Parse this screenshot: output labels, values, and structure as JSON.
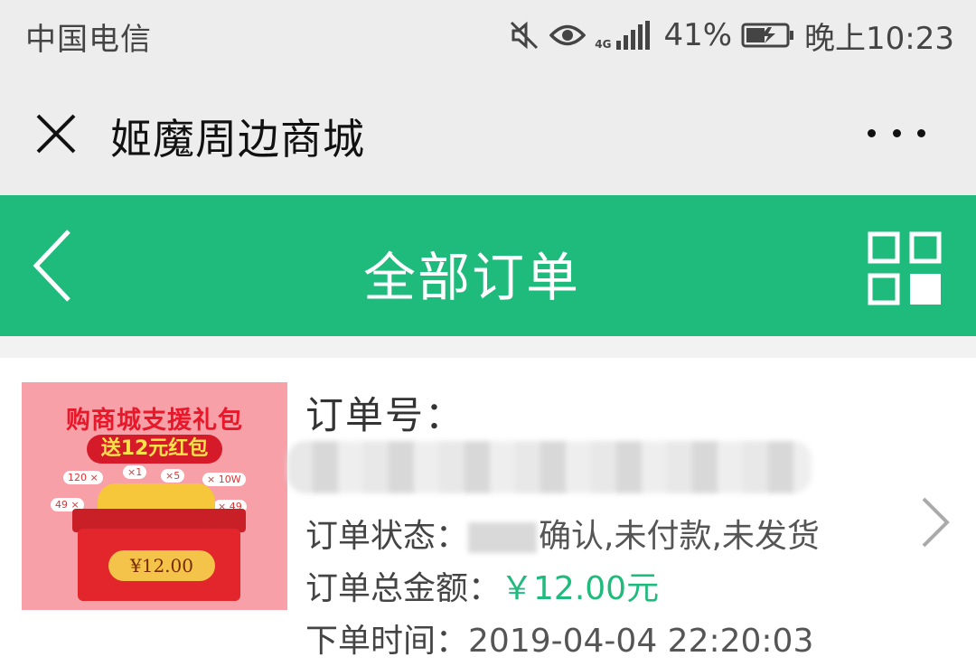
{
  "status_bar": {
    "carrier": "中国电信",
    "network": "4G",
    "battery": "41%",
    "time": "晚上10:23",
    "icons": [
      "mute-icon",
      "eye-icon",
      "signal-icon",
      "battery-charging-icon"
    ]
  },
  "wechat_bar": {
    "title": "姬魔周边商城",
    "close_icon": "close-icon",
    "more_icon": "more-icon"
  },
  "page_header": {
    "title": "全部订单",
    "back_icon": "chevron-left-icon",
    "menu_icon": "grid-icon",
    "color": "#1fbb7c"
  },
  "order": {
    "thumb": {
      "banner_line1": "购商城支援礼包",
      "banner_line2": "送12元红包",
      "price_badge": "¥12.00",
      "tags": [
        "120 ×",
        "×1",
        "×5",
        "× 10W",
        "49 ×",
        "× 49"
      ]
    },
    "order_no_label": "订单号：",
    "status_label": "订单状态：",
    "status_value": "确认,未付款,未发货",
    "amount_label": "订单总金额：",
    "amount_value": "￥12.00元",
    "time_label": "下单时间：",
    "time_value": "2019-04-04 22:20:03",
    "chevron_icon": "chevron-right-icon"
  }
}
